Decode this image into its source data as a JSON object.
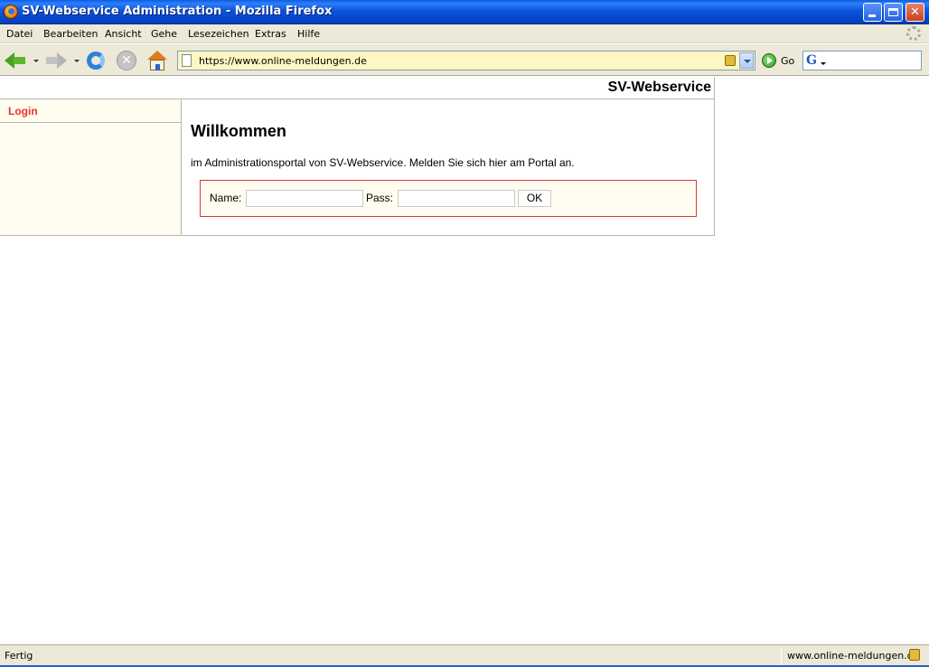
{
  "window": {
    "title": "SV-Webservice Administration - Mozilla Firefox",
    "controls": {
      "minimize_icon": "minimize-icon",
      "maximize_icon": "restore-icon",
      "close_icon": "close-icon"
    }
  },
  "menubar": {
    "items": [
      {
        "label": "Datei"
      },
      {
        "label": "Bearbeiten"
      },
      {
        "label": "Ansicht"
      },
      {
        "label": "Gehe"
      },
      {
        "label": "Lesezeichen"
      },
      {
        "label": "Extras"
      },
      {
        "label": "Hilfe"
      }
    ]
  },
  "toolbar": {
    "address": {
      "url": "https://www.online-meldungen.de"
    },
    "go_label": "Go",
    "stop_glyph": "✕"
  },
  "page": {
    "site_title": "SV-Webservice",
    "sidebar": {
      "items": [
        {
          "label": "Login"
        }
      ]
    },
    "main": {
      "heading": "Willkommen",
      "intro": "im Administrationsportal von SV-Webservice. Melden Sie sich hier am Portal an.",
      "form": {
        "name_label": "Name:",
        "name_value": "",
        "pass_label": "Pass:",
        "pass_value": "",
        "submit_label": "OK"
      }
    },
    "colors": {
      "accent_red": "#e8332a",
      "panel_bg": "#fefdf0",
      "form_border": "#d33b3b"
    }
  },
  "statusbar": {
    "status": "Fertig",
    "host": "www.online-meldungen.de"
  }
}
